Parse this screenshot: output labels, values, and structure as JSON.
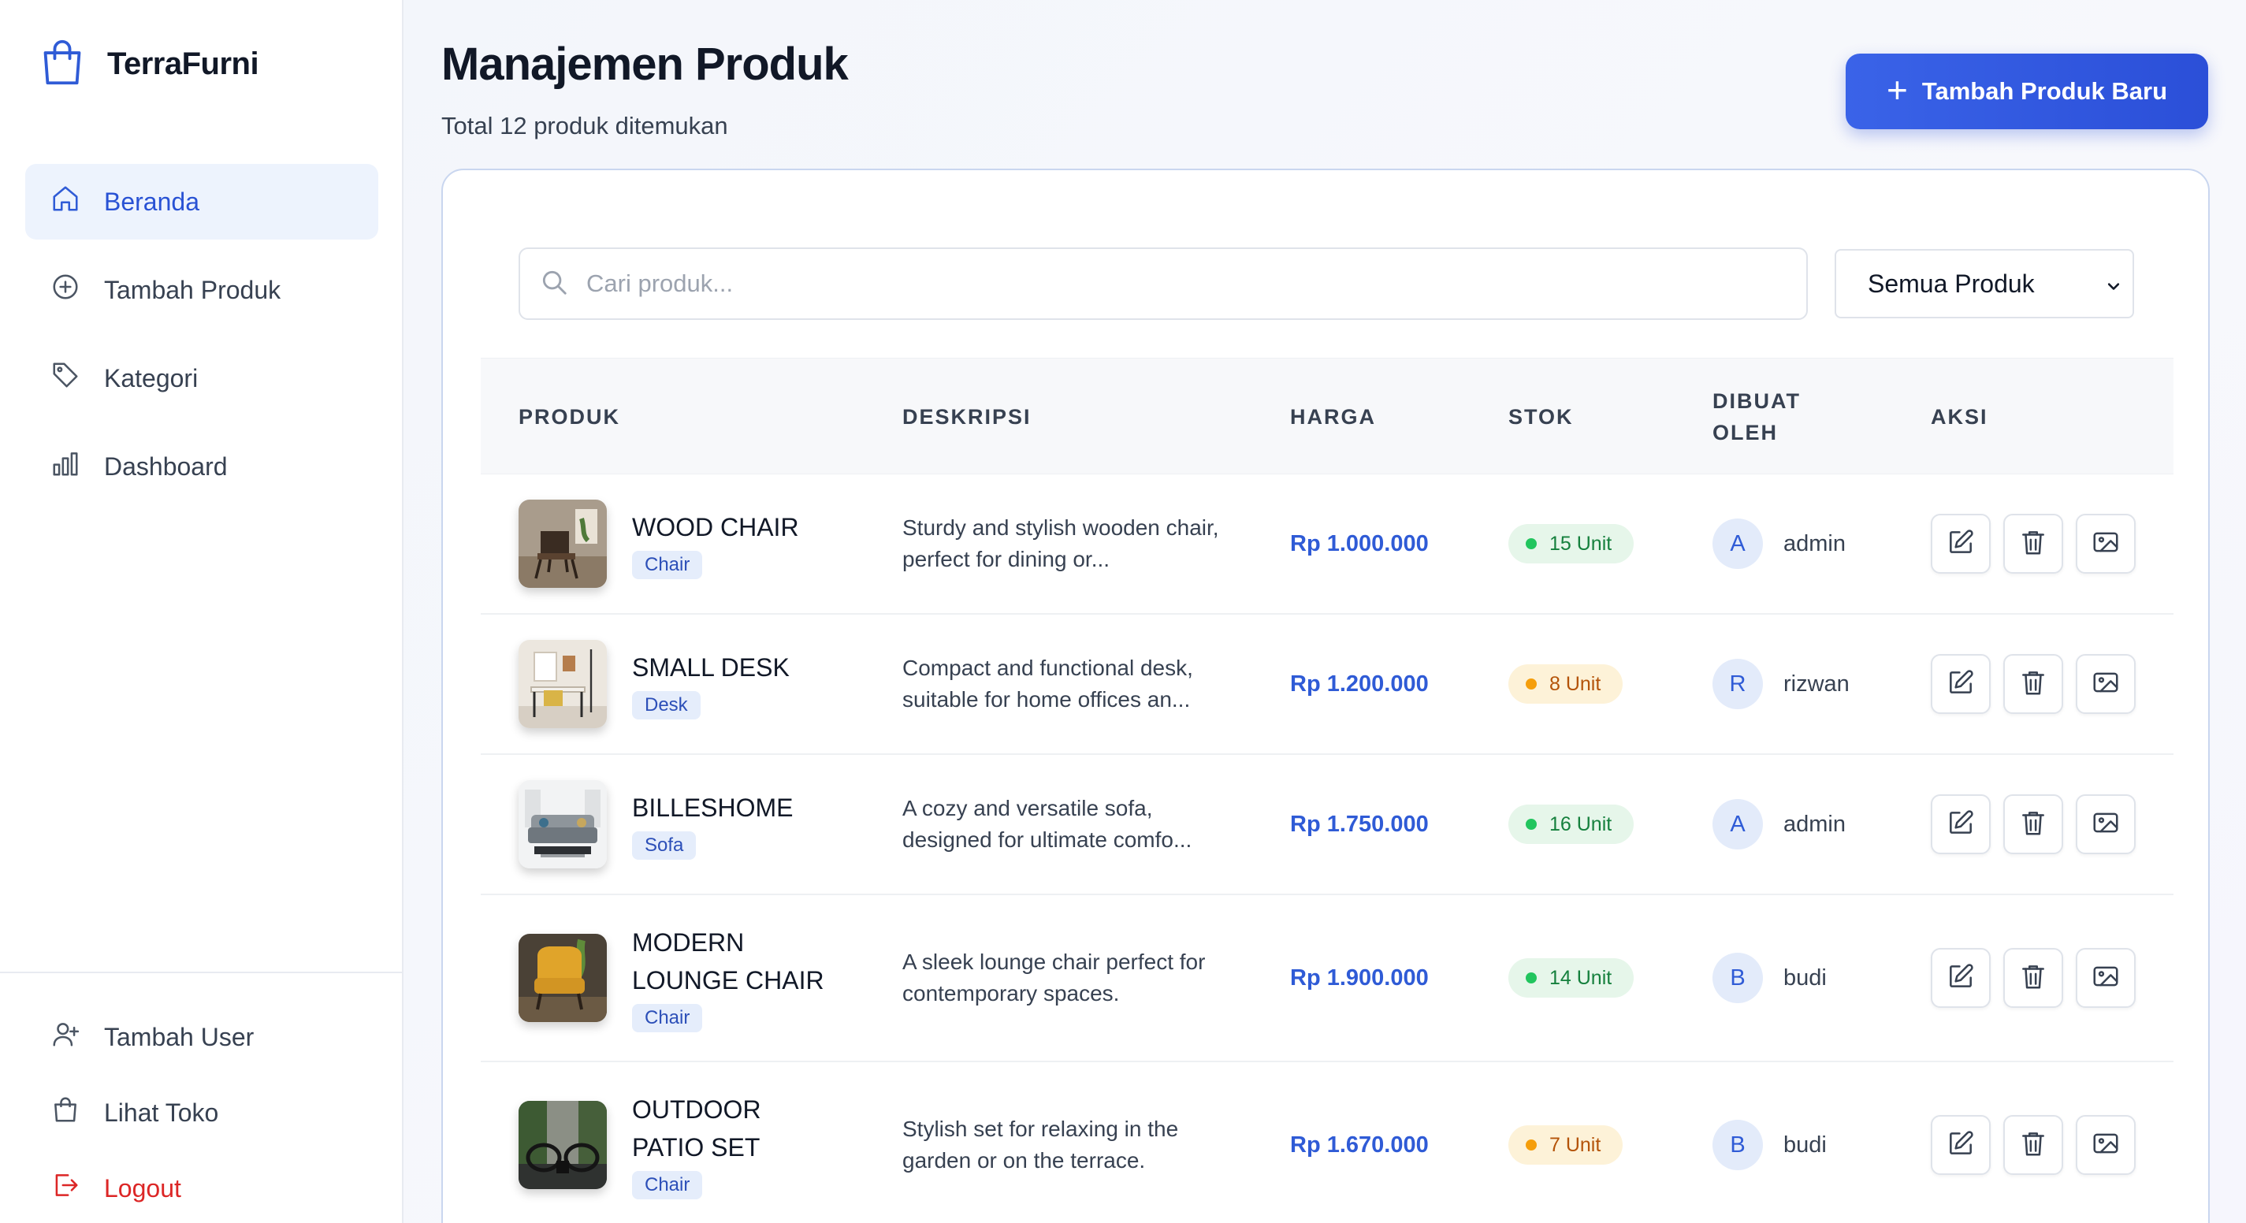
{
  "brand": {
    "name": "TerraFurni"
  },
  "sidebar": {
    "items": [
      {
        "label": "Beranda",
        "icon": "home-icon",
        "active": true
      },
      {
        "label": "Tambah Produk",
        "icon": "plus-circle-icon"
      },
      {
        "label": "Kategori",
        "icon": "tag-icon"
      },
      {
        "label": "Dashboard",
        "icon": "bar-chart-icon"
      }
    ],
    "bottom": [
      {
        "label": "Tambah User",
        "icon": "user-plus-icon"
      },
      {
        "label": "Lihat Toko",
        "icon": "shopping-bag-icon"
      },
      {
        "label": "Logout",
        "icon": "logout-icon"
      }
    ]
  },
  "header": {
    "title": "Manajemen Produk",
    "subtitle": "Total 12 produk ditemukan",
    "add_button": "Tambah Produk Baru"
  },
  "filters": {
    "search_placeholder": "Cari produk...",
    "search_value": "",
    "category_selected": "Semua Produk"
  },
  "table": {
    "columns": [
      "PRODUK",
      "DESKRIPSI",
      "HARGA",
      "STOK",
      "DIBUAT OLEH",
      "AKSI"
    ],
    "rows": [
      {
        "name": "WOOD CHAIR",
        "category": "Chair",
        "desc": "Sturdy and stylish wooden chair, perfect for dining or...",
        "price": "Rp 1.000.000",
        "stock": "15 Unit",
        "stock_level": "ok",
        "initial": "A",
        "user": "admin",
        "thumb": "wood-chair"
      },
      {
        "name": "SMALL DESK",
        "category": "Desk",
        "desc": "Compact and functional desk, suitable for home offices an...",
        "price": "Rp 1.200.000",
        "stock": "8 Unit",
        "stock_level": "low",
        "initial": "R",
        "user": "rizwan",
        "thumb": "small-desk"
      },
      {
        "name": "BILLESHOME",
        "category": "Sofa",
        "desc": "A cozy and versatile sofa, designed for ultimate comfo...",
        "price": "Rp 1.750.000",
        "stock": "16 Unit",
        "stock_level": "ok",
        "initial": "A",
        "user": "admin",
        "thumb": "sofa"
      },
      {
        "name": "MODERN LOUNGE CHAIR",
        "category": "Chair",
        "desc": "A sleek lounge chair perfect for contemporary spaces.",
        "price": "Rp 1.900.000",
        "stock": "14 Unit",
        "stock_level": "ok",
        "initial": "B",
        "user": "budi",
        "thumb": "lounge-chair"
      },
      {
        "name": "OUTDOOR PATIO SET",
        "category": "Chair",
        "desc": "Stylish set for relaxing in the garden or on the terrace.",
        "price": "Rp 1.670.000",
        "stock": "7 Unit",
        "stock_level": "low",
        "initial": "B",
        "user": "budi",
        "thumb": "patio-set"
      }
    ]
  },
  "colors": {
    "accent": "#2f5bd6",
    "logout": "#dc2626",
    "stock_ok": "#22c55e",
    "stock_low": "#f59e0b"
  }
}
